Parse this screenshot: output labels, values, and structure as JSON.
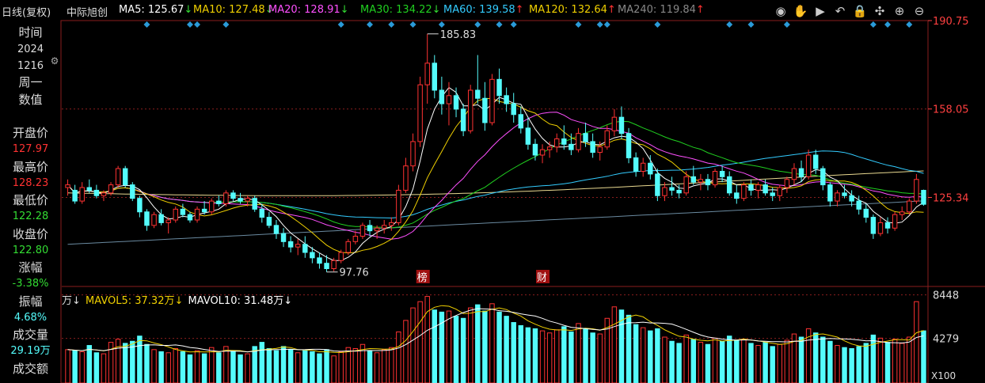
{
  "header": {
    "period": "日线(复权)",
    "stock": "中际旭创",
    "ma": [
      {
        "label": "MA5: 125.67",
        "arrow": "↓",
        "color": "#ffffff"
      },
      {
        "label": "MA10: 127.48",
        "arrow": "↓",
        "color": "#f0d000"
      },
      {
        "label": "MA20: 128.91",
        "arrow": "↓",
        "color": "#ff50ff"
      },
      {
        "label": "MA30: 134.22",
        "arrow": "↓",
        "color": "#20d020"
      },
      {
        "label": "MA60: 139.58",
        "arrow": "↑",
        "color": "#33ccff"
      },
      {
        "label": "MA120: 132.64",
        "arrow": "↑",
        "color": "#f0d000"
      },
      {
        "label": "MA240: 119.84",
        "arrow": "↑",
        "color": "#888888"
      }
    ]
  },
  "toolbar": {
    "icons": [
      "eye-icon",
      "hand-icon",
      "play-icon",
      "undo-icon",
      "lock-icon",
      "crosshair-icon",
      "zoom-in-icon",
      "zoom-out-icon"
    ]
  },
  "info": {
    "time_label": "时间",
    "year": "2024",
    "date": "1216",
    "weekday": "周一",
    "value_label": "数值",
    "open_label": "开盘价",
    "open": "127.97",
    "high_label": "最高价",
    "high": "128.23",
    "low_label": "最低价",
    "low": "122.28",
    "close_label": "收盘价",
    "close": "122.80",
    "chg_label": "涨幅",
    "chg": "-3.38%",
    "amp_label": "振幅",
    "amp": "4.68%",
    "vol_label": "成交量",
    "vol": "29.19万",
    "amt_label": "成交额"
  },
  "volume_legend": {
    "unit": "万↓",
    "mavol5": "MAVOL5: 37.32万↓",
    "mavol10": "MAVOL10: 31.48万↓"
  },
  "colors": {
    "up": "#ff3232",
    "down": "#54fcfc",
    "grid": "#8a1e1e",
    "axis": "#ff4040"
  },
  "chart_data": {
    "type": "candlestick",
    "price_axis": {
      "ticks": [
        "190.75",
        "158.05",
        "125.34"
      ],
      "ylim": [
        93,
        190.75
      ]
    },
    "volume_axis": {
      "ticks": [
        "8448",
        "4279"
      ],
      "unit": "X100"
    },
    "annotations": {
      "high": "185.83",
      "low": "97.76",
      "marker1": "榜",
      "marker2": "财"
    },
    "candles": [
      [
        129,
        132,
        126,
        130,
        3200
      ],
      [
        128,
        130,
        123,
        124,
        3100
      ],
      [
        124,
        131,
        123,
        129,
        3000
      ],
      [
        129,
        132,
        127,
        128,
        3600
      ],
      [
        128,
        130,
        125,
        126,
        2900
      ],
      [
        126,
        128,
        124,
        127,
        2800
      ],
      [
        127,
        131,
        126,
        130,
        3900
      ],
      [
        130,
        137,
        129,
        136,
        4200
      ],
      [
        136,
        137,
        129,
        130,
        3800
      ],
      [
        130,
        131,
        124,
        125,
        4000
      ],
      [
        125,
        126,
        118,
        120,
        4500
      ],
      [
        120,
        121,
        113,
        115,
        3700
      ],
      [
        115,
        120,
        114,
        119,
        3200
      ],
      [
        119,
        121,
        115,
        116,
        3000
      ],
      [
        116,
        118,
        112,
        117,
        2900
      ],
      [
        117,
        122,
        116,
        121,
        3300
      ],
      [
        121,
        123,
        118,
        119,
        3000
      ],
      [
        119,
        120,
        116,
        117,
        2700
      ],
      [
        117,
        122,
        116,
        121,
        3100
      ],
      [
        121,
        124,
        119,
        120,
        2800
      ],
      [
        120,
        125,
        119,
        124,
        3400
      ],
      [
        124,
        126,
        122,
        123,
        2900
      ],
      [
        123,
        128,
        122,
        127,
        3500
      ],
      [
        127,
        128,
        124,
        125,
        3000
      ],
      [
        125,
        127,
        123,
        124,
        2700
      ],
      [
        124,
        126,
        122,
        125,
        2800
      ],
      [
        125,
        126,
        120,
        121,
        3500
      ],
      [
        121,
        123,
        116,
        118,
        3900
      ],
      [
        118,
        120,
        114,
        115,
        3300
      ],
      [
        115,
        117,
        110,
        112,
        3100
      ],
      [
        112,
        114,
        107,
        109,
        3500
      ],
      [
        109,
        111,
        105,
        107,
        3200
      ],
      [
        107,
        110,
        104,
        108,
        2900
      ],
      [
        108,
        111,
        103,
        105,
        3100
      ],
      [
        105,
        107,
        101,
        103,
        3000
      ],
      [
        103,
        105,
        99,
        101,
        2800
      ],
      [
        101,
        104,
        97.76,
        99,
        3200
      ],
      [
        99,
        103,
        98,
        102,
        2600
      ],
      [
        102,
        106,
        101,
        105,
        3000
      ],
      [
        105,
        110,
        104,
        109,
        3400
      ],
      [
        109,
        113,
        108,
        111,
        3300
      ],
      [
        111,
        116,
        110,
        115,
        3700
      ],
      [
        115,
        117,
        111,
        113,
        3100
      ],
      [
        113,
        115,
        110,
        114,
        2900
      ],
      [
        114,
        117,
        112,
        115,
        3200
      ],
      [
        115,
        118,
        113,
        116,
        3400
      ],
      [
        116,
        130,
        115,
        128,
        4900
      ],
      [
        128,
        140,
        127,
        137,
        6000
      ],
      [
        137,
        149,
        135,
        146,
        7200
      ],
      [
        146,
        170,
        144,
        167,
        7800
      ],
      [
        167,
        185.83,
        160,
        175,
        8300
      ],
      [
        175,
        178,
        162,
        165,
        7000
      ],
      [
        165,
        170,
        156,
        160,
        6800
      ],
      [
        160,
        168,
        152,
        163,
        6900
      ],
      [
        163,
        166,
        155,
        158,
        6400
      ],
      [
        158,
        160,
        148,
        150,
        6200
      ],
      [
        150,
        167,
        149,
        165,
        7200
      ],
      [
        165,
        178,
        160,
        162,
        7500
      ],
      [
        162,
        168,
        150,
        153,
        6900
      ],
      [
        153,
        171,
        152,
        169,
        7600
      ],
      [
        169,
        173,
        160,
        163,
        6800
      ],
      [
        163,
        166,
        157,
        160,
        6400
      ],
      [
        160,
        164,
        153,
        156,
        5800
      ],
      [
        156,
        159,
        149,
        151,
        5500
      ],
      [
        151,
        155,
        143,
        145,
        5300
      ],
      [
        145,
        147,
        139,
        141,
        5200
      ],
      [
        141,
        145,
        138,
        143,
        5000
      ],
      [
        143,
        146,
        140,
        144,
        4800
      ],
      [
        144,
        149,
        142,
        147,
        5100
      ],
      [
        147,
        152,
        143,
        145,
        5400
      ],
      [
        145,
        149,
        141,
        143,
        4900
      ],
      [
        143,
        151,
        142,
        149,
        5700
      ],
      [
        149,
        153,
        144,
        146,
        5200
      ],
      [
        146,
        149,
        140,
        142,
        4800
      ],
      [
        142,
        146,
        139,
        144,
        4700
      ],
      [
        144,
        152,
        143,
        150,
        6200
      ],
      [
        150,
        158,
        148,
        155,
        7300
      ],
      [
        155,
        159,
        147,
        149,
        7000
      ],
      [
        149,
        151,
        138,
        140,
        6500
      ],
      [
        140,
        142,
        133,
        135,
        5600
      ],
      [
        135,
        140,
        133,
        138,
        5300
      ],
      [
        138,
        141,
        132,
        134,
        5000
      ],
      [
        134,
        136,
        124,
        126,
        5200
      ],
      [
        126,
        131,
        124,
        129,
        4400
      ],
      [
        129,
        133,
        126,
        128,
        4000
      ],
      [
        128,
        130,
        125,
        127,
        3800
      ],
      [
        127,
        135,
        126,
        133,
        4600
      ],
      [
        133,
        137,
        130,
        131,
        4200
      ],
      [
        131,
        134,
        128,
        132,
        3900
      ],
      [
        132,
        134,
        128,
        130,
        3700
      ],
      [
        130,
        136,
        129,
        135,
        4300
      ],
      [
        135,
        137,
        131,
        133,
        4000
      ],
      [
        133,
        135,
        126,
        127,
        4500
      ],
      [
        127,
        130,
        123,
        125,
        4100
      ],
      [
        125,
        131,
        124,
        130,
        4200
      ],
      [
        130,
        132,
        126,
        128,
        3800
      ],
      [
        128,
        131,
        125,
        130,
        3600
      ],
      [
        130,
        132,
        126,
        127,
        3900
      ],
      [
        127,
        129,
        124,
        126,
        3500
      ],
      [
        126,
        130,
        124,
        129,
        3700
      ],
      [
        129,
        133,
        127,
        132,
        4100
      ],
      [
        132,
        138,
        130,
        136,
        4700
      ],
      [
        136,
        139,
        131,
        133,
        4400
      ],
      [
        133,
        143,
        132,
        141,
        5200
      ],
      [
        141,
        143,
        134,
        136,
        4800
      ],
      [
        136,
        137,
        128,
        130,
        4400
      ],
      [
        130,
        131,
        122,
        124,
        4000
      ],
      [
        124,
        128,
        122,
        127,
        3600
      ],
      [
        127,
        130,
        125,
        126,
        3400
      ],
      [
        126,
        128,
        122,
        124,
        3300
      ],
      [
        124,
        126,
        119,
        121,
        3500
      ],
      [
        121,
        123,
        116,
        118,
        3800
      ],
      [
        118,
        119,
        110,
        112,
        4600
      ],
      [
        112,
        118,
        111,
        116,
        4300
      ],
      [
        116,
        118,
        112,
        114,
        3900
      ],
      [
        114,
        120,
        113,
        119,
        4200
      ],
      [
        119,
        122,
        117,
        120,
        3800
      ],
      [
        120,
        125,
        119,
        124,
        4400
      ],
      [
        124,
        134,
        123,
        132,
        7800
      ],
      [
        127.97,
        128.23,
        122.28,
        122.8,
        5000
      ]
    ]
  }
}
